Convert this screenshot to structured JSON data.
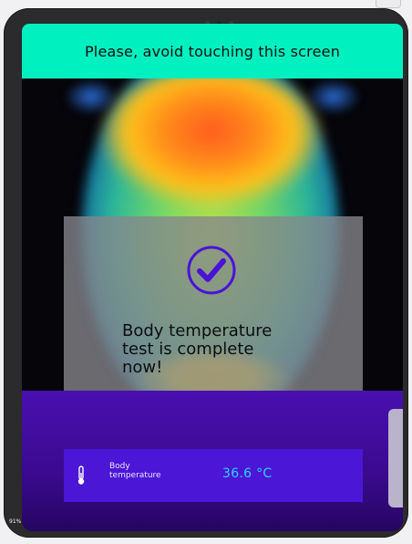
{
  "banner": {
    "text": "Please, avoid touching this screen"
  },
  "status_dialog": {
    "icon": "check-circle-icon",
    "message_line1": "Body temperature",
    "message_line2": "test is complete",
    "message_line3": "now!"
  },
  "reading": {
    "icon": "thermometer-icon",
    "label_line1": "Body",
    "label_line2": "temperature",
    "value": "36.6 °C"
  },
  "device": {
    "battery": "91%"
  },
  "colors": {
    "banner": "#00f0c0",
    "panel": "#4a0fb0",
    "card": "#4b16d6",
    "value": "#2fd3ff",
    "check": "#4a12d8"
  }
}
